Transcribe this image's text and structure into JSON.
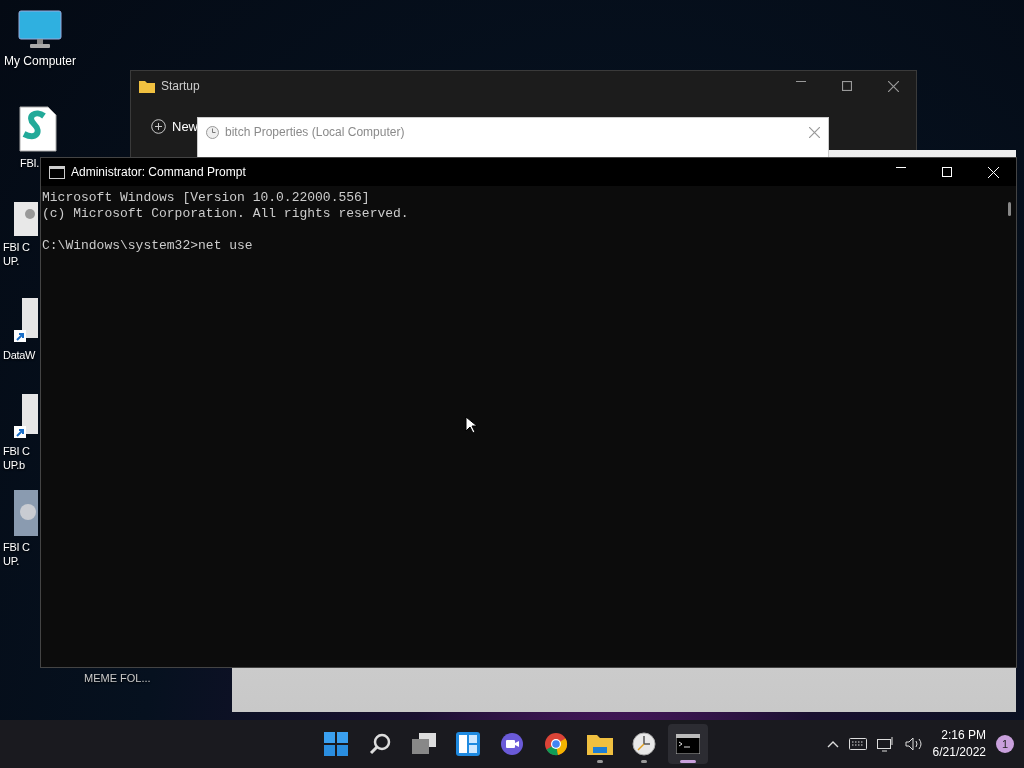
{
  "desktop_icons": [
    {
      "kind": "monitor",
      "lines": [
        "My Computer"
      ]
    },
    {
      "kind": "script",
      "lines": [
        "FBI."
      ]
    },
    {
      "kind": "gear-file",
      "lines": [
        "FBI C",
        "UP."
      ]
    },
    {
      "kind": "shortcut",
      "lines": [
        "DataW"
      ]
    },
    {
      "kind": "shortcut",
      "lines": [
        "FBI C",
        "UP.b"
      ]
    },
    {
      "kind": "image-file",
      "lines": [
        "FBI C",
        "UP."
      ]
    },
    {
      "kind": "folder-label",
      "lines": [
        "MEME FOL..."
      ]
    }
  ],
  "explorer_window": {
    "title": "Startup",
    "new_button": "New"
  },
  "properties_dialog": {
    "title": "bitch Properties (Local Computer)"
  },
  "command_prompt": {
    "title": "Administrator: Command Prompt",
    "lines": [
      "Microsoft Windows [Version 10.0.22000.556]",
      "(c) Microsoft Corporation. All rights reserved."
    ],
    "prompt": "C:\\Windows\\system32>net use"
  },
  "taskbar": {
    "apps": [
      {
        "kind": "start",
        "running": false,
        "selected": false
      },
      {
        "kind": "search",
        "running": false,
        "selected": false
      },
      {
        "kind": "task-view",
        "running": false,
        "selected": false
      },
      {
        "kind": "widgets",
        "running": false,
        "selected": false
      },
      {
        "kind": "chat",
        "running": false,
        "selected": false
      },
      {
        "kind": "chrome",
        "running": false,
        "selected": false
      },
      {
        "kind": "folder",
        "running": true,
        "selected": false
      },
      {
        "kind": "clock",
        "running": true,
        "selected": false
      },
      {
        "kind": "terminal",
        "running": true,
        "selected": true
      }
    ],
    "time": "2:16 PM",
    "date": "6/21/2022",
    "notifications": "1"
  }
}
